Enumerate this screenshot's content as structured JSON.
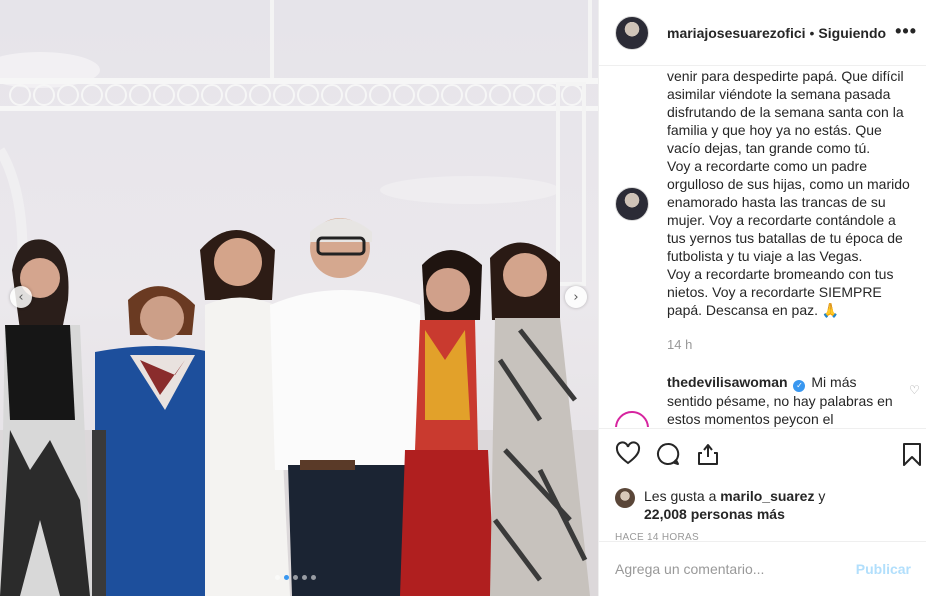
{
  "post": {
    "username": "mariajosesuarezofici",
    "separator": "•",
    "follow_status": "Siguiendo",
    "more_icon": "•••",
    "caption": "venir para despedirte papá. Que difícil\nasimilar viéndote la semana pasada\ndisfrutando de la semana santa con la\nfamilia y que hoy ya no estás. Que\nvacío dejas, tan grande como tú.\nVoy a recordarte como un padre\norgulloso de sus hijas, como un marido\nenamorado hasta las trancas de su\nmujer. Voy a recordarte contándole a\ntus yernos tus batallas de tu época de\nfutbolista y tu viaje a las Vegas.\nVoy a recordarte bromeando con tus\nnietos. Voy a recordarte SIEMPRE\npapá. Descansa en paz. 🙏",
    "caption_time": "14 h"
  },
  "comment": {
    "username": "thedevilisawoman",
    "verified_mark": "✓",
    "text": "Mi más sentido pésame, no hay palabras en estos momentos peycon el",
    "like_icon": "♡"
  },
  "carousel": {
    "prev": "‹",
    "next": "›",
    "total": 5,
    "active": 1
  },
  "likes": {
    "prefix": "Les gusta a ",
    "first_user": "marilo_suarez",
    "middle": " y",
    "count": "22,008 personas más"
  },
  "timestamp": "HACE 14 HORAS",
  "composer": {
    "placeholder": "Agrega un comentario...",
    "publish_label": "Publicar"
  },
  "colors": {
    "link_blue": "#3897f0",
    "publish_disabled": "#b2dffc",
    "muted": "#999999"
  }
}
